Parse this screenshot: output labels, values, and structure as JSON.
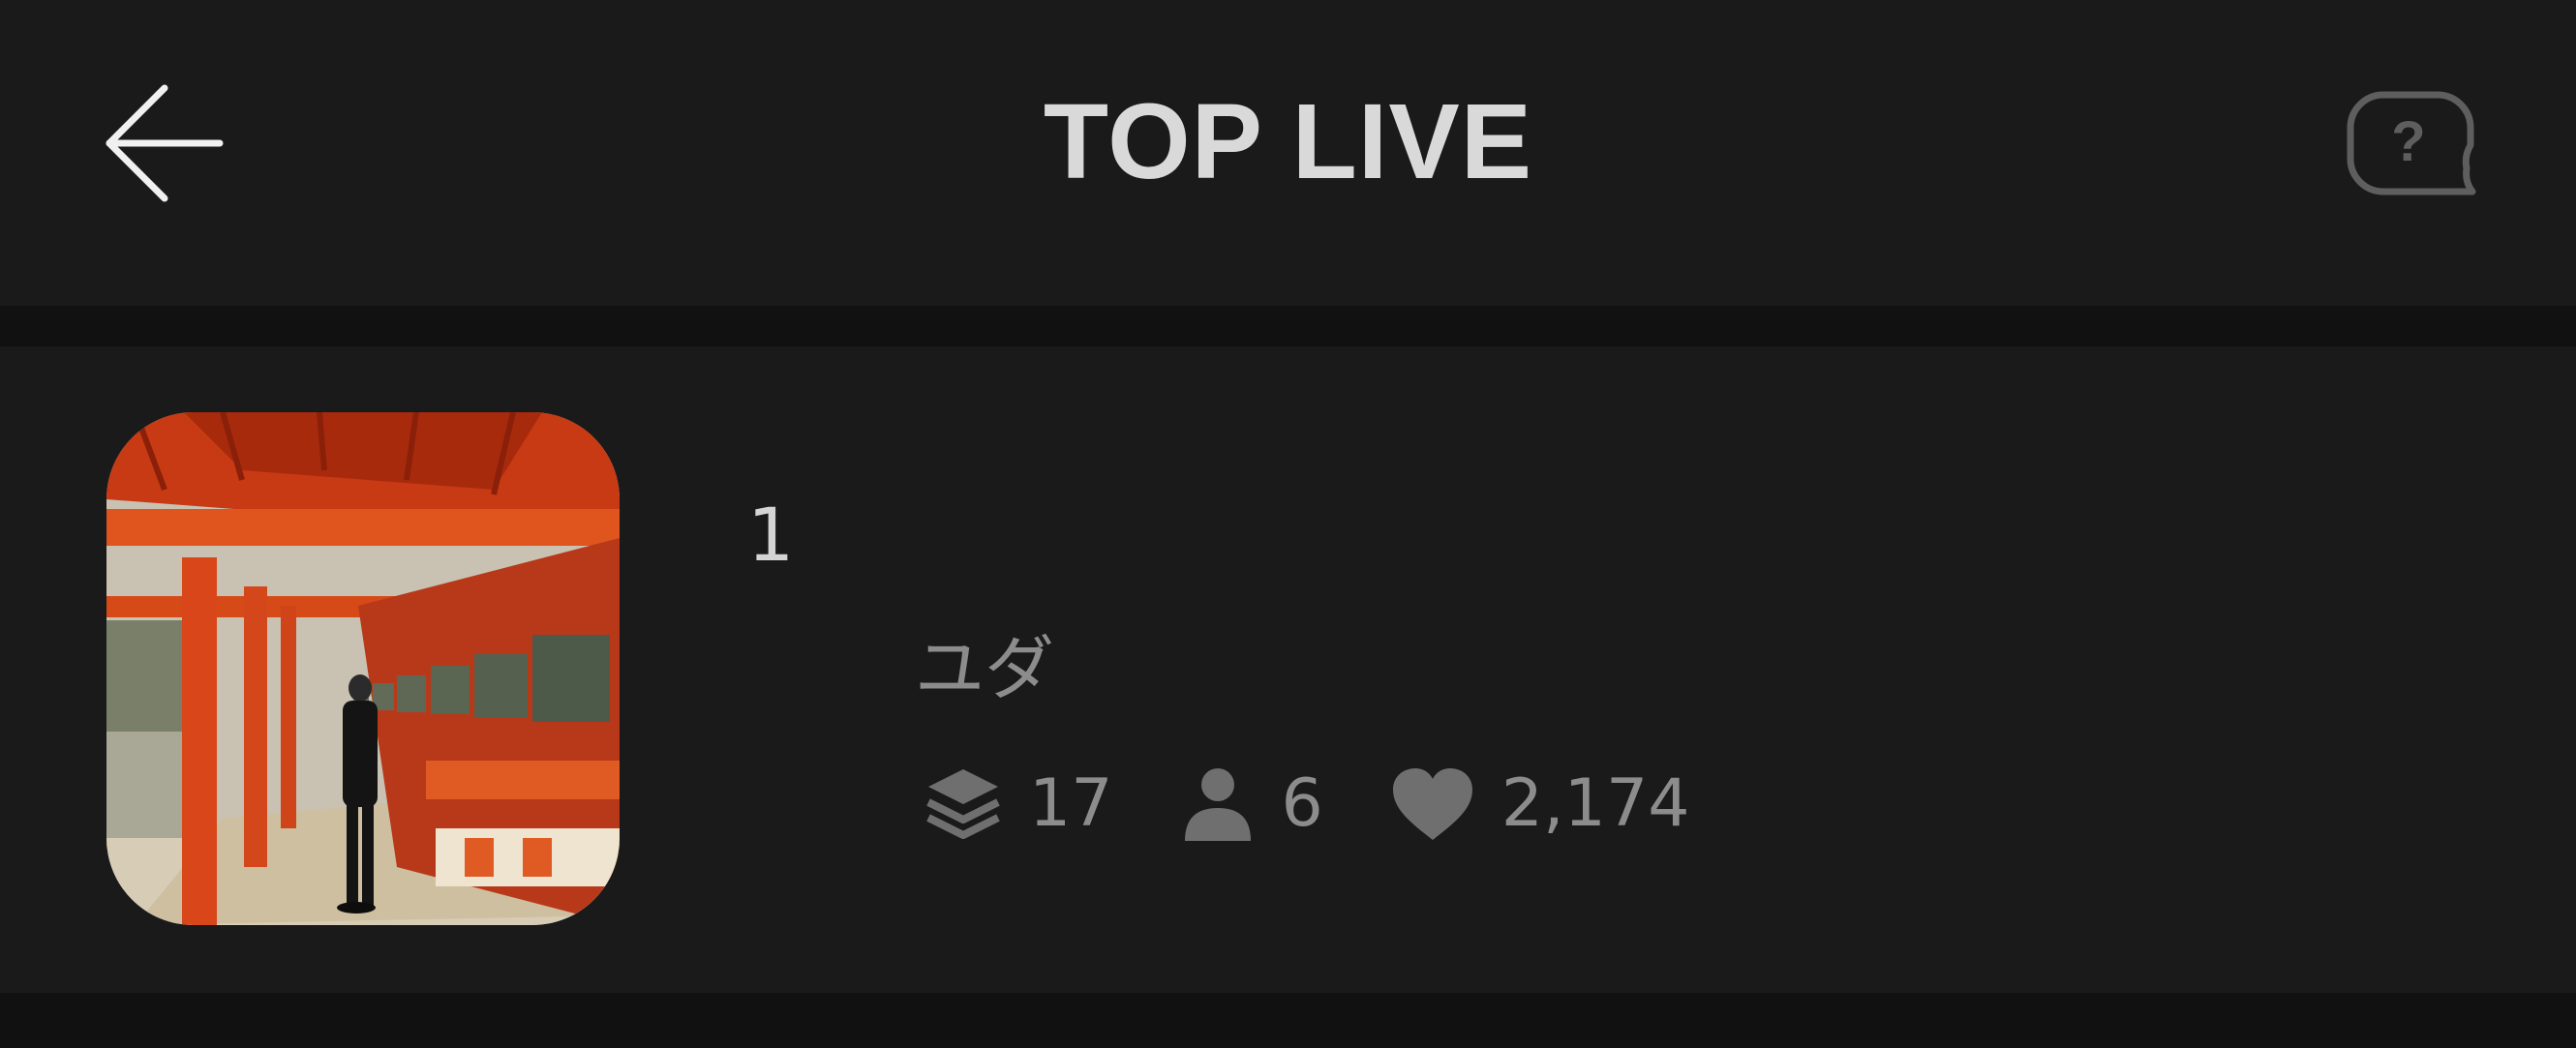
{
  "header": {
    "title": "TOP LIVE",
    "back_icon": "arrow-left-icon",
    "help_icon": "question-chat-icon"
  },
  "colors": {
    "background": "#111111",
    "surface": "#1a1a1a",
    "title": "#d9d9d9",
    "muted": "#8c8c8c",
    "icon": "#6f6f6f"
  },
  "items": [
    {
      "rank": "1",
      "name": "ユダ",
      "thumbnail": "shrine-corridor-photo",
      "stats": [
        {
          "icon": "layers-icon",
          "value": "17"
        },
        {
          "icon": "person-icon",
          "value": "6"
        },
        {
          "icon": "heart-icon",
          "value": "2,174"
        }
      ]
    }
  ]
}
